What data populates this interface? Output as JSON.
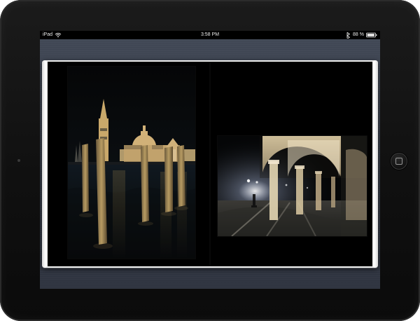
{
  "status_bar": {
    "device_label": "iPad",
    "time": "3:58 PM",
    "battery_percent": "88 %",
    "icons": {
      "wifi": "wifi-icon",
      "bluetooth": "bluetooth-icon",
      "battery": "battery-icon"
    }
  },
  "colors": {
    "device_bezel": "#111111",
    "chrome_fabric": "#3a404c",
    "page_paper": "#f2f2f2",
    "spread_background": "#000000"
  }
}
